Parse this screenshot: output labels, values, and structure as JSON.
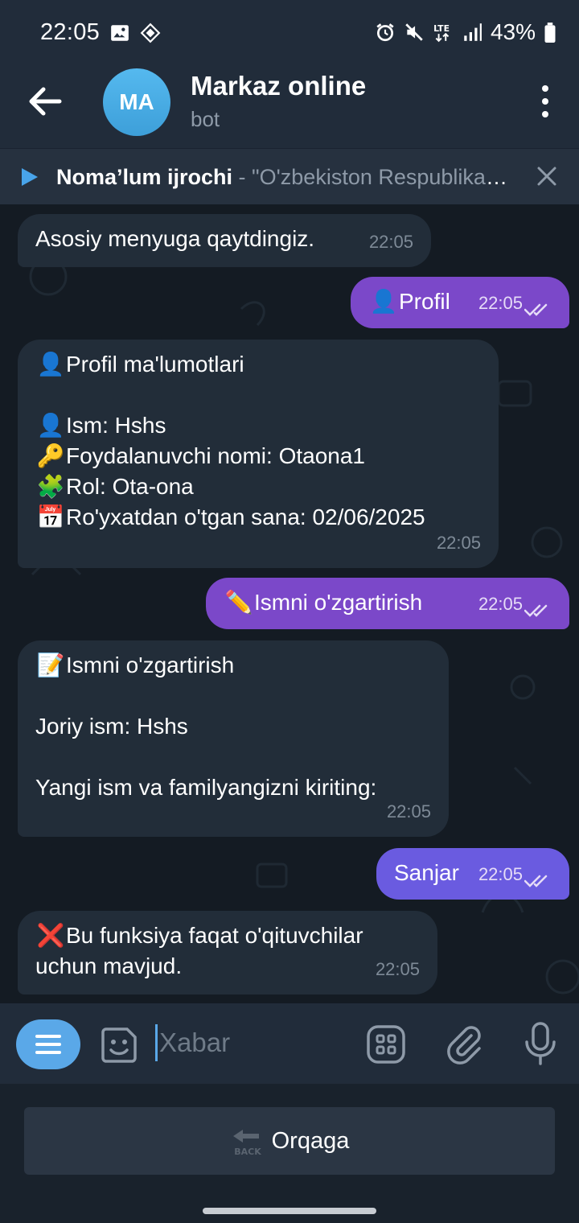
{
  "status_bar": {
    "time": "22:05",
    "network": "LTE",
    "battery": "43%",
    "icons": [
      "gallery-icon",
      "chip-icon",
      "alarm-icon",
      "mute-icon",
      "lte-icon",
      "signal-icon",
      "battery-icon"
    ]
  },
  "header": {
    "avatar_initials": "MA",
    "title": "Markaz online",
    "subtitle": "bot"
  },
  "player": {
    "artist": "Noma’lum ijrochi",
    "separator": " - ",
    "song": "\"O'zbekiston Respublikasi Davlat madhiyasi\""
  },
  "messages": {
    "m1": {
      "text": "Asosiy menyuga qaytdingiz.",
      "time": "22:05"
    },
    "m2": {
      "emoji": "👤",
      "text": "Profil",
      "time": "22:05"
    },
    "m3": {
      "l1_emoji": "👤",
      "l1": "Profil ma'lumotlari",
      "l2_emoji": "👤",
      "l2": "Ism: Hshs",
      "l3_emoji": "🔑",
      "l3": "Foydalanuvchi nomi: Otaona1",
      "l4_emoji": "🧩",
      "l4": "Rol: Ota-ona",
      "l5_emoji": "📅",
      "l5": "Ro'yxatdan o'tgan sana: 02/06/2025",
      "time": "22:05"
    },
    "m4": {
      "emoji": "✏️",
      "text": "Ismni o'zgartirish",
      "time": "22:05"
    },
    "m5": {
      "l1_emoji": "📝",
      "l1": "Ismni o'zgartirish",
      "l2": "Joriy ism: Hshs",
      "l3": "Yangi ism va familyangizni kiriting:",
      "time": "22:05"
    },
    "m6": {
      "text": "Sanjar",
      "time": "22:05"
    },
    "m7": {
      "emoji": "❌",
      "l1": "Bu funksiya faqat o'qituvchilar",
      "l2": "uchun mavjud.",
      "time": "22:05"
    }
  },
  "composer": {
    "placeholder": "Xabar"
  },
  "keyboard": {
    "back_label": "Orqaga",
    "back_icon_text": "BACK"
  },
  "colors": {
    "outgoing_bubble": "#7b48c9",
    "outgoing_bubble_alt": "#6a5be0",
    "incoming_bubble": "#222d39",
    "accent": "#5aa8e8"
  }
}
